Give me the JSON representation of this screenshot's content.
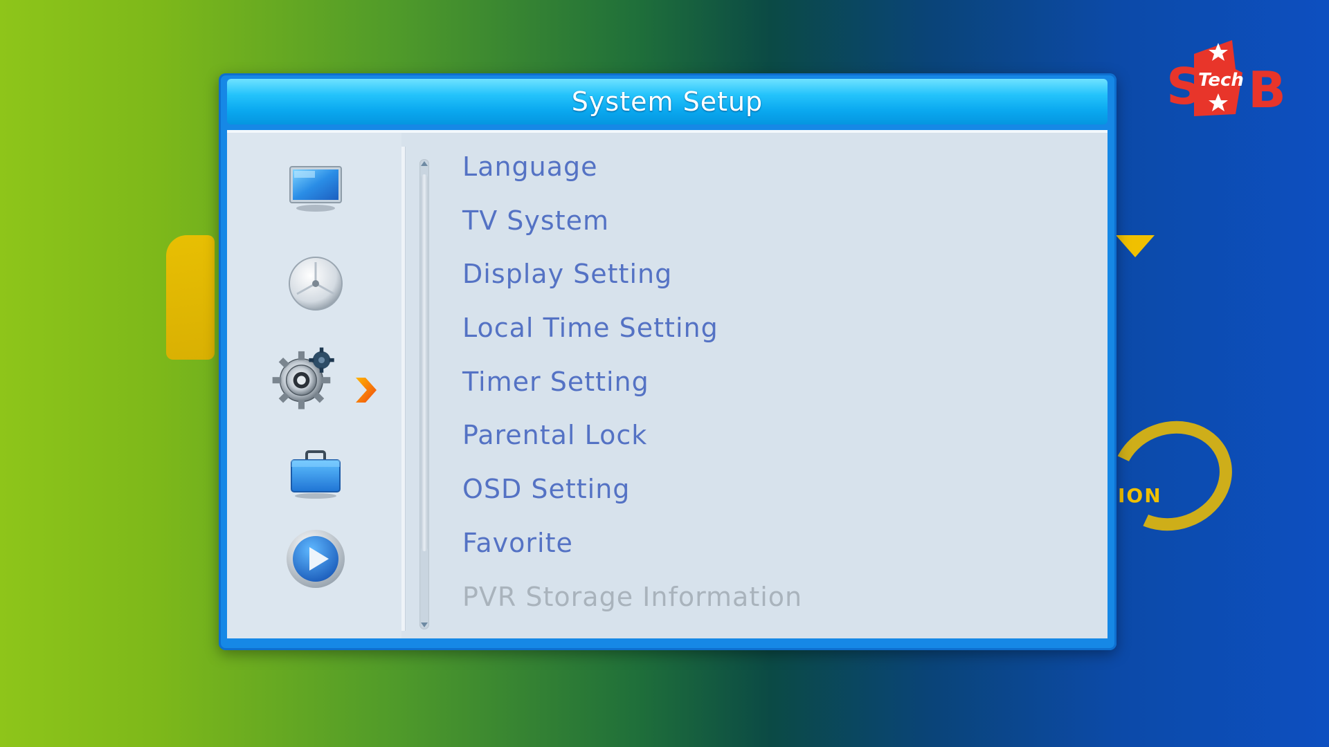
{
  "dialog": {
    "title": "System Setup"
  },
  "channel_logo": {
    "text": "Tech",
    "accent_color": "#e8352a"
  },
  "background": {
    "watermark_text": "ION"
  },
  "sidebar": {
    "items": [
      {
        "icon": "tv-icon",
        "selected": false
      },
      {
        "icon": "satellite-dish-icon",
        "selected": false
      },
      {
        "icon": "gear-icon",
        "selected": true
      },
      {
        "icon": "toolbox-icon",
        "selected": false
      },
      {
        "icon": "play-icon",
        "selected": false
      }
    ],
    "selected_indicator": "chevron-right-icon"
  },
  "menu": {
    "items": [
      {
        "label": "Language",
        "enabled": true
      },
      {
        "label": "TV System",
        "enabled": true
      },
      {
        "label": "Display Setting",
        "enabled": true
      },
      {
        "label": "Local Time Setting",
        "enabled": true
      },
      {
        "label": "Timer Setting",
        "enabled": true
      },
      {
        "label": "Parental Lock",
        "enabled": true
      },
      {
        "label": "OSD Setting",
        "enabled": true
      },
      {
        "label": "Favorite",
        "enabled": true
      },
      {
        "label": "PVR Storage Information",
        "enabled": false
      }
    ]
  },
  "colors": {
    "title_bar": "#0aa8ef",
    "menu_text": "#5472c4",
    "menu_text_disabled": "#a9b3bc",
    "panel_bg": "#d7e2ec",
    "dialog_border": "#1688e6"
  }
}
